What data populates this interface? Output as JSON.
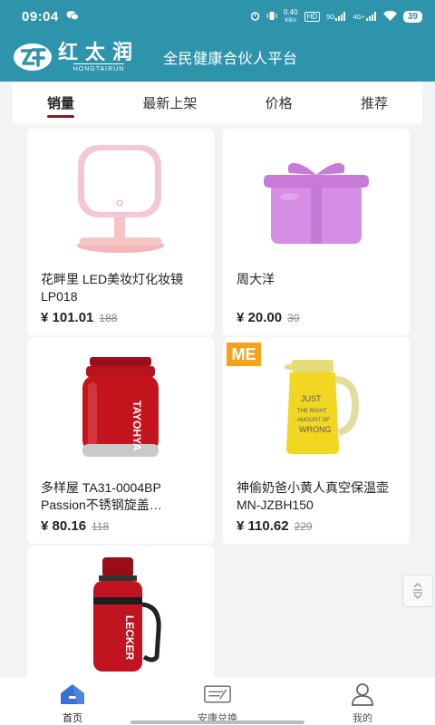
{
  "status_bar": {
    "time": "09:04",
    "speed_value": "0.40",
    "speed_unit": "KB/s",
    "hd_label": "HD",
    "sig1_label": "5G",
    "sig2_label": "4G+",
    "battery": "39"
  },
  "header": {
    "logo_cn": "红太润",
    "logo_en": "HONGTAIRUN",
    "slogan": "全民健康合伙人平台"
  },
  "tabs": [
    {
      "label": "销量",
      "active": true
    },
    {
      "label": "最新上架",
      "active": false
    },
    {
      "label": "价格",
      "active": false
    },
    {
      "label": "推荐",
      "active": false
    }
  ],
  "products": [
    {
      "title": "花畔里 LED美妆灯化妆镜 LP018",
      "price": "¥ 101.01",
      "old_price": "188",
      "image": "pink-mirror"
    },
    {
      "title": "周大洋",
      "price": "¥ 20.00",
      "old_price": "30",
      "image": "purple-gift"
    },
    {
      "title": "多样屋 TA31-0004BP Passion不锈钢旋盖…",
      "price": "¥ 80.16",
      "old_price": "118",
      "image": "red-food-jar"
    },
    {
      "title": "神偷奶爸小黄人真空保温壶 MN-JZBH150",
      "price": "¥ 110.62",
      "old_price": "229",
      "image": "yellow-kettle",
      "brand_text": "ME"
    },
    {
      "title": "",
      "price": "",
      "old_price": "",
      "image": "red-thermos",
      "brand_text": "LECKER"
    }
  ],
  "bottom_nav": [
    {
      "label": "首页",
      "icon": "home-icon",
      "active": true
    },
    {
      "label": "安康兑换",
      "icon": "ticket-icon",
      "active": false
    },
    {
      "label": "我的",
      "icon": "person-icon",
      "active": false
    }
  ],
  "colors": {
    "brand": "#2e94ab",
    "tab_indicator": "#7a1f24",
    "nav_active": "#3a6fd8"
  }
}
